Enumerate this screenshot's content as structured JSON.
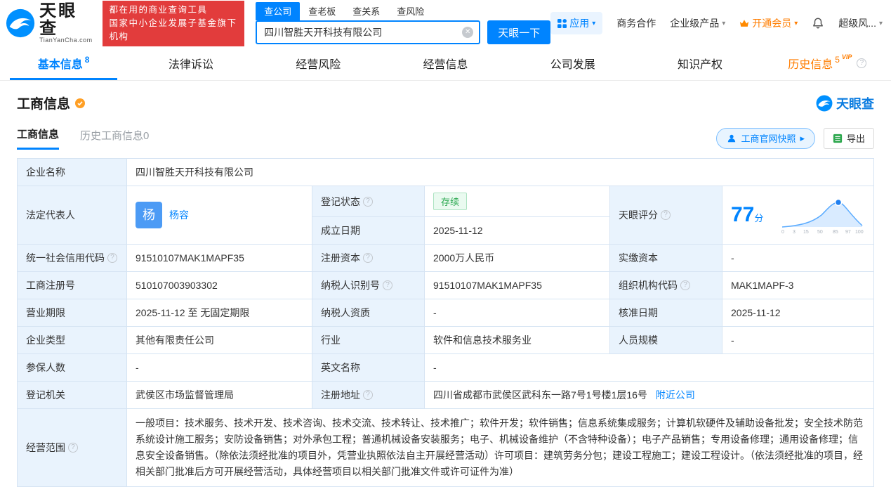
{
  "brand": {
    "name": "天眼查",
    "domain": "TianYanCha.com",
    "slogan_line1": "都在用的商业查询工具",
    "slogan_line2": "国家中小企业发展子基金旗下机构",
    "colors": {
      "primary": "#0084ff",
      "red": "#e23c3c",
      "orange": "#ff7d00",
      "green": "#28a74e",
      "label_bg": "#e9f3fd"
    }
  },
  "search": {
    "tabs": [
      {
        "label": "查公司"
      },
      {
        "label": "查老板"
      },
      {
        "label": "查关系"
      },
      {
        "label": "查风险"
      }
    ],
    "value": "四川智胜天开科技有限公司",
    "button": "天眼一下"
  },
  "top_nav": {
    "apps": "应用",
    "cooperation": "商务合作",
    "enterprise": "企业级产品",
    "vip": "开通会员",
    "super_risk": "超级风..."
  },
  "tabs": [
    {
      "label": "基本信息",
      "count": "8"
    },
    {
      "label": "法律诉讼"
    },
    {
      "label": "经营风险"
    },
    {
      "label": "经营信息"
    },
    {
      "label": "公司发展"
    },
    {
      "label": "知识产权"
    },
    {
      "label": "历史信息",
      "count": "5",
      "badge": "VIP"
    }
  ],
  "section": {
    "title": "工商信息",
    "watermark": "天眼查",
    "subtab_active": "工商信息",
    "subtab_history": "历史工商信息0",
    "snapshot_button": "工商官网快照",
    "export_button": "导出"
  },
  "info": {
    "company_name": {
      "label": "企业名称",
      "value": "四川智胜天开科技有限公司"
    },
    "legal_rep": {
      "label": "法定代表人",
      "avatar": "杨",
      "name": "杨容"
    },
    "reg_status": {
      "label": "登记状态",
      "value": "存续"
    },
    "est_date": {
      "label": "成立日期",
      "value": "2025-11-12"
    },
    "credit_code": {
      "label": "统一社会信用代码",
      "value": "91510107MAK1MAPF35"
    },
    "reg_capital": {
      "label": "注册资本",
      "value": "2000万人民币"
    },
    "paid_capital": {
      "label": "实缴资本",
      "value": "-"
    },
    "reg_no": {
      "label": "工商注册号",
      "value": "510107003903302"
    },
    "taxpayer_no": {
      "label": "纳税人识别号",
      "value": "91510107MAK1MAPF35"
    },
    "org_code": {
      "label": "组织机构代码",
      "value": "MAK1MAPF-3"
    },
    "term": {
      "label": "营业期限",
      "value": "2025-11-12 至 无固定期限"
    },
    "taxpayer_quality": {
      "label": "纳税人资质",
      "value": "-"
    },
    "approved_date": {
      "label": "核准日期",
      "value": "2025-11-12"
    },
    "company_type": {
      "label": "企业类型",
      "value": "其他有限责任公司"
    },
    "industry": {
      "label": "行业",
      "value": "软件和信息技术服务业"
    },
    "staff_size": {
      "label": "人员规模",
      "value": "-"
    },
    "insured_num": {
      "label": "参保人数",
      "value": "-"
    },
    "english_name": {
      "label": "英文名称",
      "value": "-"
    },
    "reg_authority": {
      "label": "登记机关",
      "value": "武侯区市场监督管理局"
    },
    "address": {
      "label": "注册地址",
      "value": "四川省成都市武侯区武科东一路7号1号楼1层16号",
      "link": "附近公司"
    },
    "scope": {
      "label": "经营范围",
      "value": "一般项目：技术服务、技术开发、技术咨询、技术交流、技术转让、技术推广；软件开发；软件销售；信息系统集成服务；计算机软硬件及辅助设备批发；安全技术防范系统设计施工服务；安防设备销售；对外承包工程；普通机械设备安装服务；电子、机械设备维护（不含特种设备）；电子产品销售；专用设备修理；通用设备修理；信息安全设备销售。（除依法须经批准的项目外，凭营业执照依法自主开展经营活动）许可项目：建筑劳务分包；建设工程施工；建设工程设计。（依法须经批准的项目，经相关部门批准后方可开展经营活动，具体经营项目以相关部门批准文件或许可证件为准）"
    }
  },
  "score_chart": {
    "type": "line",
    "label": "天眼评分",
    "score": "77",
    "unit": "分",
    "ticks": [
      "0",
      "3",
      "15",
      "50",
      "85",
      "97",
      "100"
    ]
  }
}
